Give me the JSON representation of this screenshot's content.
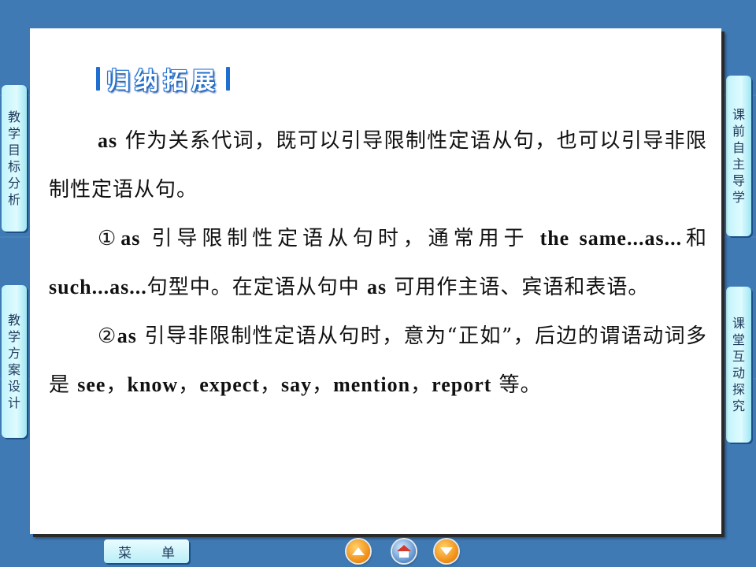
{
  "slide": {
    "title": "归纳拓展",
    "paragraphs": [
      [
        {
          "t": "as",
          "en": true
        },
        {
          "t": " 作为关系代词，既可以引导限制性定语从句，也可以引导非限制性定语从句。",
          "en": false
        }
      ],
      [
        {
          "t": "①",
          "en": false
        },
        {
          "t": "as",
          "en": true
        },
        {
          "t": " 引导限制性定语从句时，通常用于 ",
          "en": false
        },
        {
          "t": "the same...as...",
          "en": true
        },
        {
          "t": "和 ",
          "en": false
        },
        {
          "t": "such...as...",
          "en": true
        },
        {
          "t": "句型中。在定语从句中 ",
          "en": false
        },
        {
          "t": "as",
          "en": true
        },
        {
          "t": " 可用作主语、宾语和表语。",
          "en": false
        }
      ],
      [
        {
          "t": "②",
          "en": false
        },
        {
          "t": "as",
          "en": true
        },
        {
          "t": " 引导非限制性定语从句时，意为“正如”，后边的谓语动词多是 ",
          "en": false
        },
        {
          "t": "see",
          "en": true
        },
        {
          "t": "，",
          "en": false
        },
        {
          "t": "know",
          "en": true
        },
        {
          "t": "，",
          "en": false
        },
        {
          "t": "expect",
          "en": true
        },
        {
          "t": "，",
          "en": false
        },
        {
          "t": "say",
          "en": true
        },
        {
          "t": "，",
          "en": false
        },
        {
          "t": "mention",
          "en": true
        },
        {
          "t": "，",
          "en": false
        },
        {
          "t": "report",
          "en": true
        },
        {
          "t": " 等。",
          "en": false
        }
      ]
    ]
  },
  "side_nav": {
    "left": [
      {
        "label": "教学目标分析"
      },
      {
        "label": "教学方案设计"
      }
    ],
    "right": [
      {
        "label": "课前自主导学"
      },
      {
        "label": "课堂互动探究"
      }
    ]
  },
  "bottom_nav": {
    "menu_chars": [
      "菜",
      "单"
    ],
    "buttons": [
      {
        "icon": "up-arrow-icon"
      },
      {
        "icon": "home-icon"
      },
      {
        "icon": "down-arrow-icon"
      }
    ]
  },
  "colors": {
    "background": "#3f7ab5",
    "title_outline": "#1f6fd0",
    "tab_fill": "#bff4fb",
    "nav_orange": "#f08a12"
  }
}
